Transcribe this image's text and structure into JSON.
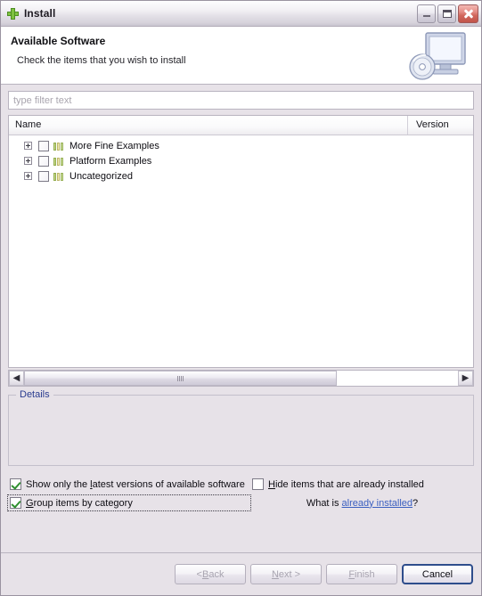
{
  "window": {
    "title": "Install",
    "title_icon": "green-plus-icon",
    "buttons": {
      "minimize": "minimize-icon",
      "maximize": "maximize-icon",
      "close": "close-icon"
    }
  },
  "banner": {
    "title": "Available Software",
    "subtitle": "Check the items that you wish to install",
    "art_icon": "monitor-disc-icon"
  },
  "filter": {
    "placeholder": "type filter text",
    "value": ""
  },
  "tree": {
    "columns": [
      {
        "label": "Name"
      },
      {
        "label": "Version"
      }
    ],
    "rows": [
      {
        "label": "More Fine Examples",
        "version": "",
        "expanded": false,
        "checked": false,
        "icon": "category-icon"
      },
      {
        "label": "Platform Examples",
        "version": "",
        "expanded": false,
        "checked": false,
        "icon": "category-icon"
      },
      {
        "label": "Uncategorized",
        "version": "",
        "expanded": false,
        "checked": false,
        "icon": "category-icon"
      }
    ]
  },
  "scrollbar": {
    "left_arrow": "◀",
    "right_arrow": "▶"
  },
  "details": {
    "legend": "Details",
    "content": ""
  },
  "options": {
    "show_latest": {
      "label_before": "Show only the ",
      "mnemonic": "l",
      "label_after": "atest versions of available software",
      "checked": true
    },
    "hide_installed": {
      "label_before": "",
      "mnemonic": "H",
      "label_after": "ide items that are already installed",
      "checked": false
    },
    "group_by_category": {
      "label_before": "",
      "mnemonic": "G",
      "label_after": "roup items by category",
      "checked": true
    },
    "whatis": {
      "prefix": "What is ",
      "link": "already installed",
      "suffix": "?"
    }
  },
  "footer": {
    "back": {
      "prefix": "< ",
      "mnemonic": "B",
      "suffix": "ack",
      "enabled": false
    },
    "next": {
      "prefix": "",
      "mnemonic": "N",
      "suffix": "ext >",
      "enabled": false
    },
    "finish": {
      "prefix": "",
      "mnemonic": "F",
      "suffix": "inish",
      "enabled": false
    },
    "cancel": {
      "label": "Cancel",
      "enabled": true
    }
  },
  "colors": {
    "dialog_bg": "#e7e2e8",
    "accent_link": "#3b5fc0",
    "legend_blue": "#2a3c8f",
    "check_green": "#2f8f2f",
    "close_red": "#c1544a"
  }
}
